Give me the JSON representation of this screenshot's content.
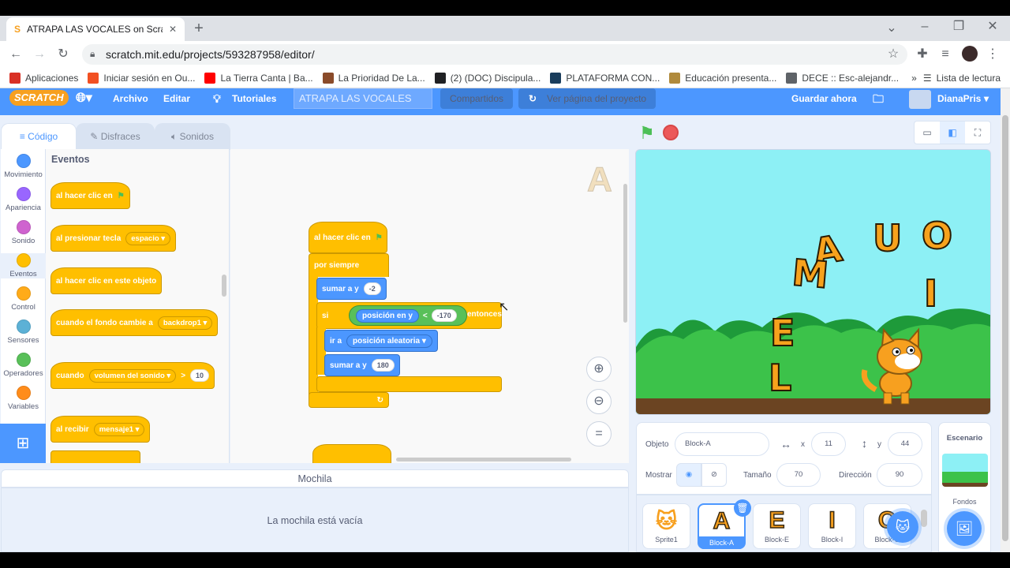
{
  "browser": {
    "tab_title": "ATRAPA LAS VOCALES on Scratch",
    "url": "scratch.mit.edu/projects/593287958/editor/",
    "bookmarks": [
      {
        "label": "Aplicaciones",
        "color": "#d93025"
      },
      {
        "label": "Iniciar sesión en Ou...",
        "color": "#f25022"
      },
      {
        "label": "La Tierra Canta | Ba...",
        "color": "#ff0000"
      },
      {
        "label": "La Prioridad De La...",
        "color": "#8a4b2a"
      },
      {
        "label": "(2) (DOC) Discipula...",
        "color": "#202124"
      },
      {
        "label": "PLATAFORMA CON...",
        "color": "#1a3d5c"
      },
      {
        "label": "Educación presenta...",
        "color": "#b08a3c"
      },
      {
        "label": "DECE :: Esc-alejandr...",
        "color": "#5f6368"
      }
    ],
    "reading_list": "Lista de lectura",
    "more": "»"
  },
  "menu": {
    "logo": "SCRATCH",
    "file": "Archivo",
    "edit": "Editar",
    "tutorials": "Tutoriales",
    "project_title": "ATRAPA LAS VOCALES",
    "shared": "Compartidos",
    "see_project": "Ver página del proyecto",
    "save_now": "Guardar ahora",
    "user": "DianaPris"
  },
  "tabs": {
    "code": "Código",
    "costumes": "Disfraces",
    "sounds": "Sonidos"
  },
  "categories": [
    {
      "label": "Movimiento",
      "color": "#4c97ff"
    },
    {
      "label": "Apariencia",
      "color": "#9966ff"
    },
    {
      "label": "Sonido",
      "color": "#cf63cf"
    },
    {
      "label": "Eventos",
      "color": "#ffbf00"
    },
    {
      "label": "Control",
      "color": "#ffab19"
    },
    {
      "label": "Sensores",
      "color": "#5cb1d6"
    },
    {
      "label": "Operadores",
      "color": "#59c059"
    },
    {
      "label": "Variables",
      "color": "#ff8c1a"
    }
  ],
  "palette": {
    "heading": "Eventos",
    "flag_click": "al hacer clic en",
    "key_press": "al presionar tecla",
    "key_value": "espacio",
    "sprite_click": "al hacer clic en este objeto",
    "backdrop_change": "cuando el fondo cambie a",
    "backdrop_value": "backdrop1",
    "when": "cuando",
    "sensor_value": "volumen del sonido",
    "gt": ">",
    "threshold": "10",
    "receive": "al recibir",
    "message": "mensaje1"
  },
  "script": {
    "hat": "al hacer clic en",
    "forever": "por siempre",
    "change_y": "sumar a y",
    "change_y_val": "-2",
    "if": "si",
    "pos_y": "posición en y",
    "lt": "<",
    "compare_val": "-170",
    "then": "entonces",
    "goto": "ir a",
    "goto_val": "posición aleatoria",
    "change_y2": "sumar a y",
    "change_y2_val": "180",
    "sprite_ghost": "A"
  },
  "backpack": {
    "title": "Mochila",
    "empty": "La mochila está vacía"
  },
  "stage": {
    "letters": [
      "A",
      "M",
      "U",
      "O",
      "I",
      "E",
      "L"
    ]
  },
  "sprite_info": {
    "object_label": "Objeto",
    "object_name": "Block-A",
    "x_label": "x",
    "x": "11",
    "y_label": "y",
    "y": "44",
    "show_label": "Mostrar",
    "size_label": "Tamaño",
    "size": "70",
    "direction_label": "Dirección",
    "direction": "90"
  },
  "sprites": [
    {
      "name": "Sprite1",
      "glyph": ""
    },
    {
      "name": "Block-A",
      "glyph": "A"
    },
    {
      "name": "Block-E",
      "glyph": "E"
    },
    {
      "name": "Block-I",
      "glyph": "I"
    },
    {
      "name": "Block-O",
      "glyph": "O"
    }
  ],
  "scene": {
    "title": "Escenario",
    "backdrops": "Fondos"
  }
}
